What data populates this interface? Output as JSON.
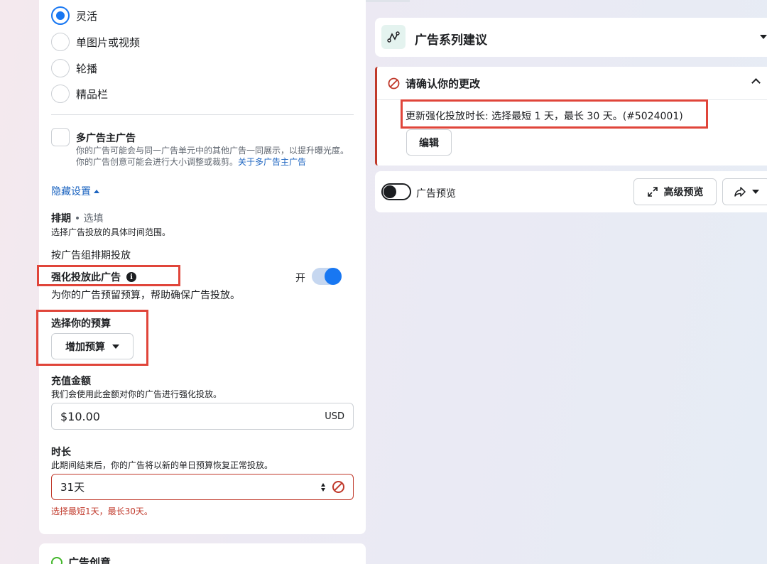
{
  "ad_format": {
    "options": [
      {
        "label": "灵活",
        "checked": true
      },
      {
        "label": "单图片或视频",
        "checked": false
      },
      {
        "label": "轮播",
        "checked": false
      },
      {
        "label": "精品栏",
        "checked": false
      }
    ]
  },
  "multi_advertiser": {
    "title": "多广告主广告",
    "description": "你的广告可能会与同一广告单元中的其他广告一同展示，以提升曝光度。你的广告创意可能会进行大小调整或裁剪。",
    "link": "关于多广告主广告"
  },
  "hide_settings": "隐藏设置",
  "schedule": {
    "title": "排期",
    "optional": "• 选填",
    "description": "选择广告投放的具体时间范围。",
    "by_group": "按广告组排期投放"
  },
  "boost": {
    "title": "强化投放此广告",
    "toggle_label": "开",
    "description": "为你的广告预留预算，帮助确保广告投放。"
  },
  "budget": {
    "title": "选择你的预算",
    "button": "增加预算"
  },
  "topup": {
    "title": "充值金额",
    "description": "我们会使用此金额对你的广告进行强化投放。",
    "value": "$10.00",
    "currency": "USD"
  },
  "duration": {
    "title": "时长",
    "description": "此期间结束后，你的广告将以新的单日预算恢复正常投放。",
    "value": "31天",
    "error": "选择最短1天，最长30天。"
  },
  "creative": {
    "title": "广告创意"
  },
  "campaign_suggestions": {
    "title": "广告系列建议"
  },
  "confirm_changes": {
    "title": "请确认你的更改",
    "message": "更新强化投放时长: 选择最短 1 天，最长 30 天。(#5024001)",
    "edit_button": "编辑"
  },
  "preview": {
    "label": "广告预览",
    "advanced_button": "高级预览"
  },
  "colors": {
    "primary": "#1877f2",
    "error": "#c0392b",
    "highlight": "#e0453a",
    "link": "#1d65c1"
  }
}
